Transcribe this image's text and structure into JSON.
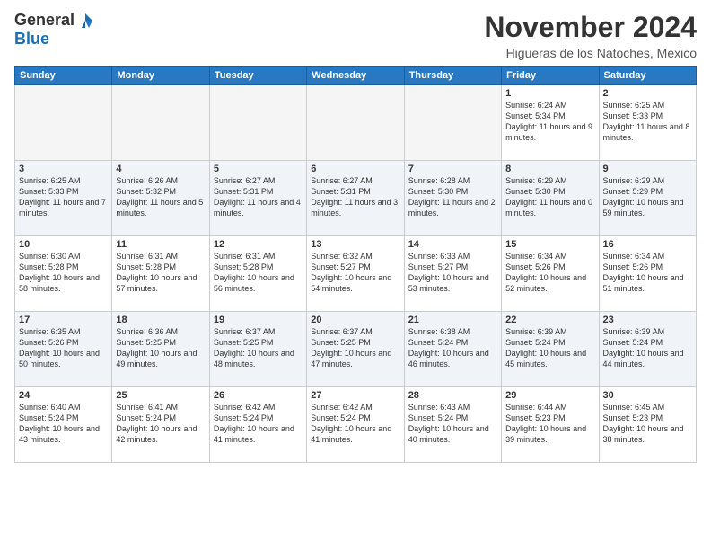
{
  "header": {
    "logo_general": "General",
    "logo_blue": "Blue",
    "month": "November 2024",
    "location": "Higueras de los Natoches, Mexico"
  },
  "weekdays": [
    "Sunday",
    "Monday",
    "Tuesday",
    "Wednesday",
    "Thursday",
    "Friday",
    "Saturday"
  ],
  "weeks": [
    [
      {
        "day": "",
        "info": ""
      },
      {
        "day": "",
        "info": ""
      },
      {
        "day": "",
        "info": ""
      },
      {
        "day": "",
        "info": ""
      },
      {
        "day": "",
        "info": ""
      },
      {
        "day": "1",
        "info": "Sunrise: 6:24 AM\nSunset: 5:34 PM\nDaylight: 11 hours and 9 minutes."
      },
      {
        "day": "2",
        "info": "Sunrise: 6:25 AM\nSunset: 5:33 PM\nDaylight: 11 hours and 8 minutes."
      }
    ],
    [
      {
        "day": "3",
        "info": "Sunrise: 6:25 AM\nSunset: 5:33 PM\nDaylight: 11 hours and 7 minutes."
      },
      {
        "day": "4",
        "info": "Sunrise: 6:26 AM\nSunset: 5:32 PM\nDaylight: 11 hours and 5 minutes."
      },
      {
        "day": "5",
        "info": "Sunrise: 6:27 AM\nSunset: 5:31 PM\nDaylight: 11 hours and 4 minutes."
      },
      {
        "day": "6",
        "info": "Sunrise: 6:27 AM\nSunset: 5:31 PM\nDaylight: 11 hours and 3 minutes."
      },
      {
        "day": "7",
        "info": "Sunrise: 6:28 AM\nSunset: 5:30 PM\nDaylight: 11 hours and 2 minutes."
      },
      {
        "day": "8",
        "info": "Sunrise: 6:29 AM\nSunset: 5:30 PM\nDaylight: 11 hours and 0 minutes."
      },
      {
        "day": "9",
        "info": "Sunrise: 6:29 AM\nSunset: 5:29 PM\nDaylight: 10 hours and 59 minutes."
      }
    ],
    [
      {
        "day": "10",
        "info": "Sunrise: 6:30 AM\nSunset: 5:28 PM\nDaylight: 10 hours and 58 minutes."
      },
      {
        "day": "11",
        "info": "Sunrise: 6:31 AM\nSunset: 5:28 PM\nDaylight: 10 hours and 57 minutes."
      },
      {
        "day": "12",
        "info": "Sunrise: 6:31 AM\nSunset: 5:28 PM\nDaylight: 10 hours and 56 minutes."
      },
      {
        "day": "13",
        "info": "Sunrise: 6:32 AM\nSunset: 5:27 PM\nDaylight: 10 hours and 54 minutes."
      },
      {
        "day": "14",
        "info": "Sunrise: 6:33 AM\nSunset: 5:27 PM\nDaylight: 10 hours and 53 minutes."
      },
      {
        "day": "15",
        "info": "Sunrise: 6:34 AM\nSunset: 5:26 PM\nDaylight: 10 hours and 52 minutes."
      },
      {
        "day": "16",
        "info": "Sunrise: 6:34 AM\nSunset: 5:26 PM\nDaylight: 10 hours and 51 minutes."
      }
    ],
    [
      {
        "day": "17",
        "info": "Sunrise: 6:35 AM\nSunset: 5:26 PM\nDaylight: 10 hours and 50 minutes."
      },
      {
        "day": "18",
        "info": "Sunrise: 6:36 AM\nSunset: 5:25 PM\nDaylight: 10 hours and 49 minutes."
      },
      {
        "day": "19",
        "info": "Sunrise: 6:37 AM\nSunset: 5:25 PM\nDaylight: 10 hours and 48 minutes."
      },
      {
        "day": "20",
        "info": "Sunrise: 6:37 AM\nSunset: 5:25 PM\nDaylight: 10 hours and 47 minutes."
      },
      {
        "day": "21",
        "info": "Sunrise: 6:38 AM\nSunset: 5:24 PM\nDaylight: 10 hours and 46 minutes."
      },
      {
        "day": "22",
        "info": "Sunrise: 6:39 AM\nSunset: 5:24 PM\nDaylight: 10 hours and 45 minutes."
      },
      {
        "day": "23",
        "info": "Sunrise: 6:39 AM\nSunset: 5:24 PM\nDaylight: 10 hours and 44 minutes."
      }
    ],
    [
      {
        "day": "24",
        "info": "Sunrise: 6:40 AM\nSunset: 5:24 PM\nDaylight: 10 hours and 43 minutes."
      },
      {
        "day": "25",
        "info": "Sunrise: 6:41 AM\nSunset: 5:24 PM\nDaylight: 10 hours and 42 minutes."
      },
      {
        "day": "26",
        "info": "Sunrise: 6:42 AM\nSunset: 5:24 PM\nDaylight: 10 hours and 41 minutes."
      },
      {
        "day": "27",
        "info": "Sunrise: 6:42 AM\nSunset: 5:24 PM\nDaylight: 10 hours and 41 minutes."
      },
      {
        "day": "28",
        "info": "Sunrise: 6:43 AM\nSunset: 5:24 PM\nDaylight: 10 hours and 40 minutes."
      },
      {
        "day": "29",
        "info": "Sunrise: 6:44 AM\nSunset: 5:23 PM\nDaylight: 10 hours and 39 minutes."
      },
      {
        "day": "30",
        "info": "Sunrise: 6:45 AM\nSunset: 5:23 PM\nDaylight: 10 hours and 38 minutes."
      }
    ]
  ]
}
